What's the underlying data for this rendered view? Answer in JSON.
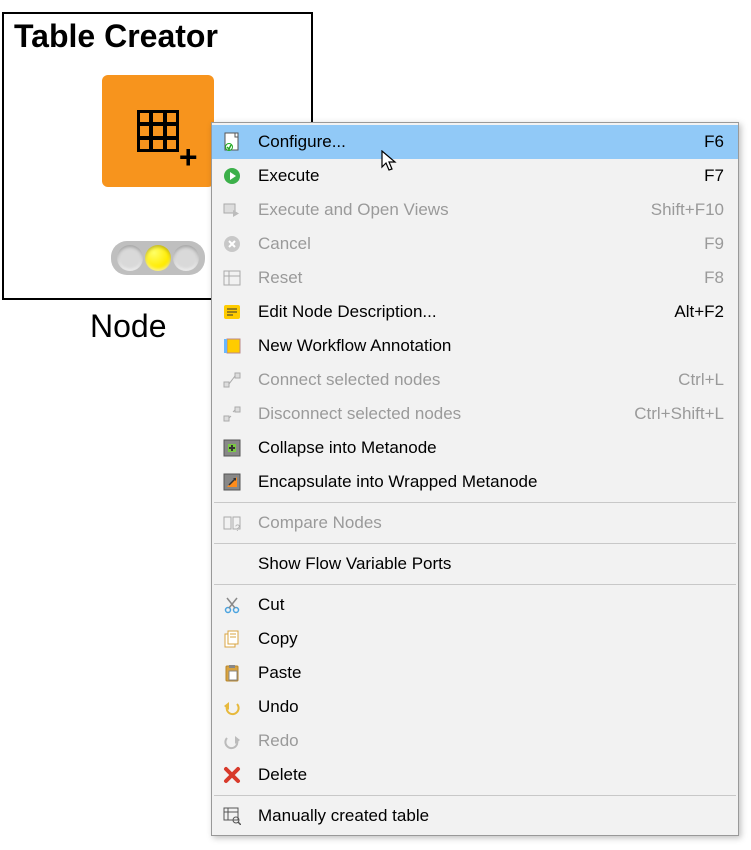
{
  "node": {
    "title": "Table Creator",
    "label": "Node",
    "color": "#f7941d",
    "status": "configured"
  },
  "menu": {
    "items": [
      {
        "icon": "doc-config",
        "label": "Configure...",
        "shortcut": "F6",
        "enabled": true,
        "selected": true
      },
      {
        "icon": "play",
        "label": "Execute",
        "shortcut": "F7",
        "enabled": true
      },
      {
        "icon": "play-views",
        "label": "Execute and Open Views",
        "shortcut": "Shift+F10",
        "enabled": false
      },
      {
        "icon": "cancel",
        "label": "Cancel",
        "shortcut": "F9",
        "enabled": false
      },
      {
        "icon": "reset",
        "label": "Reset",
        "shortcut": "F8",
        "enabled": false
      },
      {
        "icon": "edit-desc",
        "label": "Edit Node Description...",
        "shortcut": "Alt+F2",
        "enabled": true
      },
      {
        "icon": "annotation",
        "label": "New Workflow Annotation",
        "shortcut": "",
        "enabled": true
      },
      {
        "icon": "connect",
        "label": "Connect selected nodes",
        "shortcut": "Ctrl+L",
        "enabled": false
      },
      {
        "icon": "disconnect",
        "label": "Disconnect selected nodes",
        "shortcut": "Ctrl+Shift+L",
        "enabled": false
      },
      {
        "icon": "collapse",
        "label": "Collapse into Metanode",
        "shortcut": "",
        "enabled": true
      },
      {
        "icon": "encapsulate",
        "label": "Encapsulate into Wrapped Metanode",
        "shortcut": "",
        "enabled": true
      },
      {
        "sep": true
      },
      {
        "icon": "compare",
        "label": "Compare Nodes",
        "shortcut": "",
        "enabled": false
      },
      {
        "sep": true
      },
      {
        "icon": "",
        "label": "Show Flow Variable Ports",
        "shortcut": "",
        "enabled": true
      },
      {
        "sep": true
      },
      {
        "icon": "cut",
        "label": "Cut",
        "shortcut": "",
        "enabled": true
      },
      {
        "icon": "copy",
        "label": "Copy",
        "shortcut": "",
        "enabled": true
      },
      {
        "icon": "paste",
        "label": "Paste",
        "shortcut": "",
        "enabled": true
      },
      {
        "icon": "undo",
        "label": "Undo",
        "shortcut": "",
        "enabled": true
      },
      {
        "icon": "redo",
        "label": "Redo",
        "shortcut": "",
        "enabled": false
      },
      {
        "icon": "delete",
        "label": "Delete",
        "shortcut": "",
        "enabled": true
      },
      {
        "sep": true
      },
      {
        "icon": "table-search",
        "label": "Manually created table",
        "shortcut": "",
        "enabled": true
      }
    ]
  }
}
